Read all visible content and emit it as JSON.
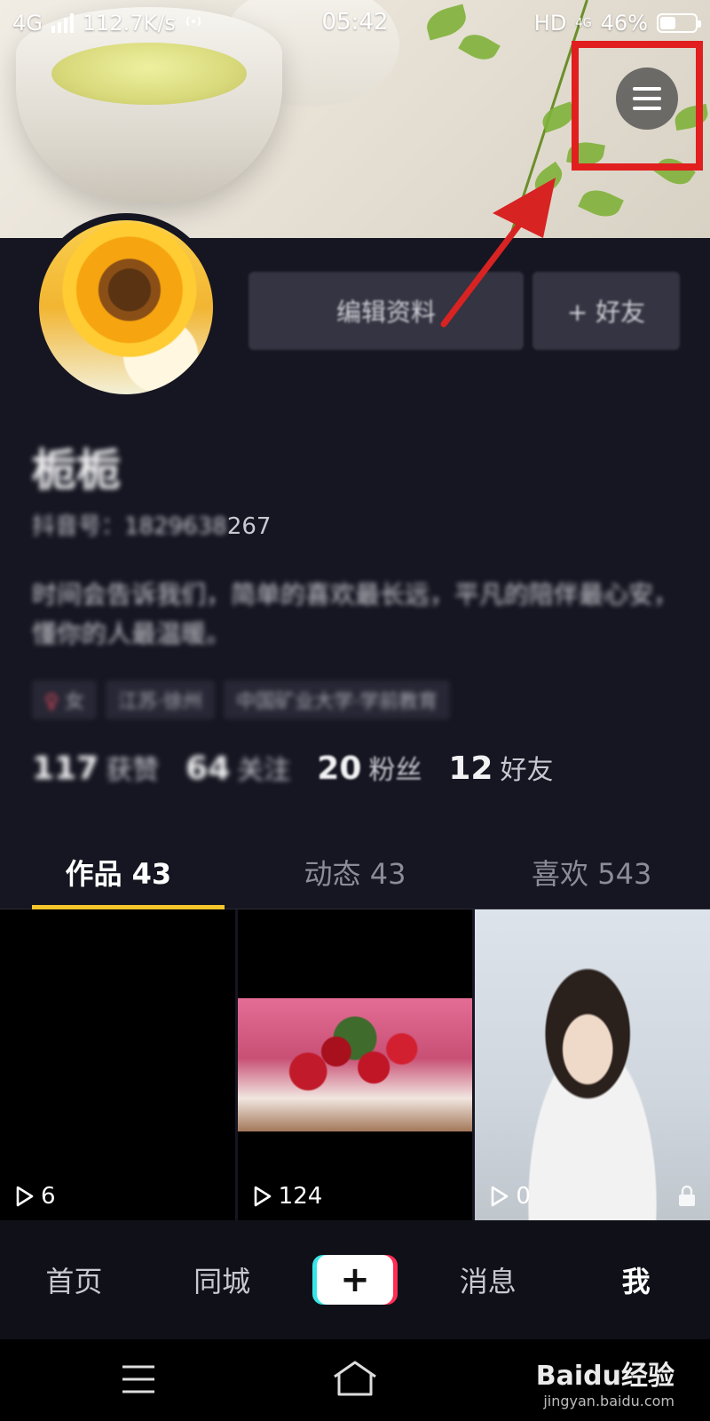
{
  "status_bar": {
    "network": "4G",
    "speed": "112.7K/s",
    "time": "05:42",
    "hd": "HD",
    "network2": "4G",
    "battery": "46%",
    "battery_level": 0.46
  },
  "profile": {
    "name": "栀栀",
    "douyin_id_label": "抖音号：",
    "douyin_id_hidden": "1829638",
    "douyin_id_visible": "267",
    "edit_button": "编辑资料",
    "add_friend_button": "+ 好友",
    "bio": "时间会告诉我们，简单的喜欢最长远，平凡的陪伴最心安，懂你的人最温暖。",
    "tags": [
      {
        "symbol": "♀",
        "text": "女"
      },
      {
        "text": "江苏·徐州"
      },
      {
        "text": "中国矿业大学·学前教育"
      }
    ]
  },
  "stats": [
    {
      "num": "117",
      "label": "获赞"
    },
    {
      "num": "64",
      "label": "关注"
    },
    {
      "num": "20",
      "label": "粉丝"
    },
    {
      "num": "12",
      "label": "好友"
    }
  ],
  "tabs": [
    {
      "label": "作品 43"
    },
    {
      "label": "动态 43"
    },
    {
      "label": "喜欢 543"
    }
  ],
  "videos": [
    {
      "plays": "6"
    },
    {
      "plays": "124"
    },
    {
      "plays": "0"
    }
  ],
  "bottom_nav": {
    "home": "首页",
    "local": "同城",
    "create": "+",
    "messages": "消息",
    "me": "我"
  },
  "watermark": {
    "logo": "Baidu经验",
    "url": "jingyan.baidu.com"
  },
  "colors": {
    "background": "#161622",
    "highlight": "#e11f1f",
    "tab_indicator": "#f5c52b"
  }
}
